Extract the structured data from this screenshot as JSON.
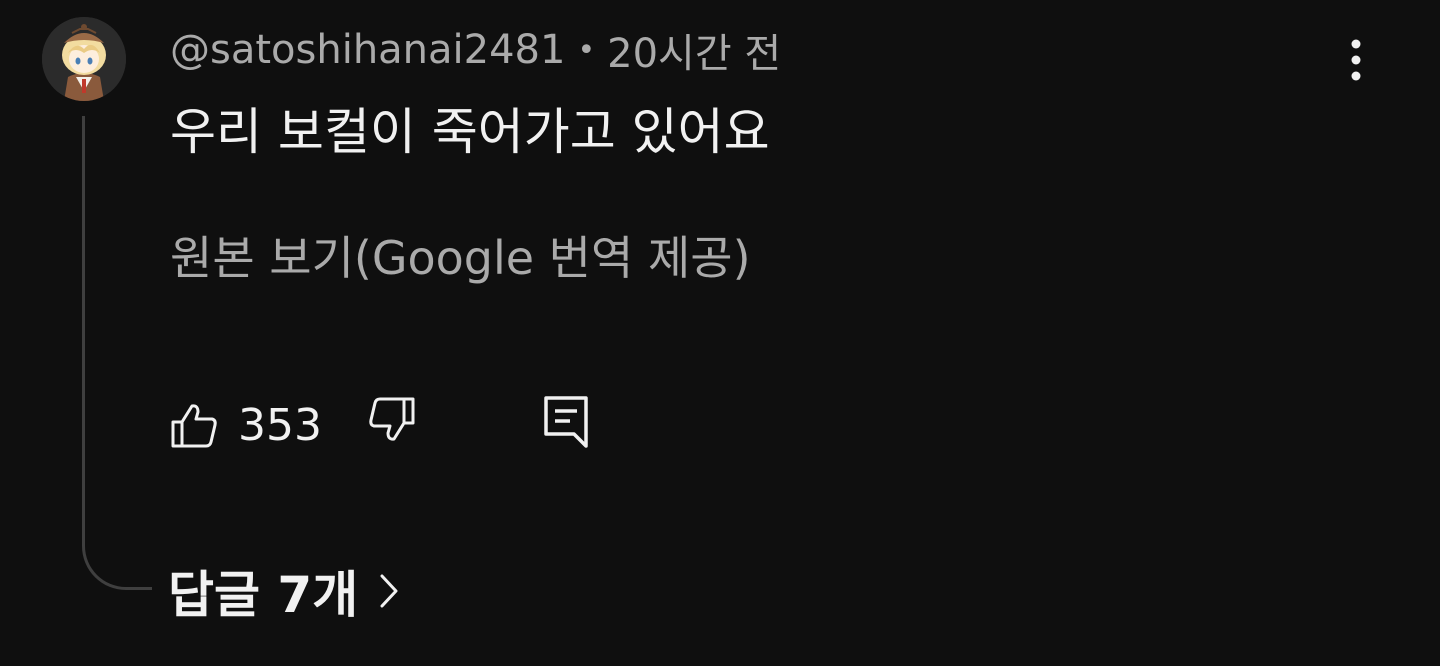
{
  "comment": {
    "author": "@satoshihanai2481",
    "separator": "•",
    "timestamp": "20시간 전",
    "text": "우리 보컬이 죽어가고 있어요",
    "translate_label": "원본 보기(Google 번역 제공)",
    "like_count": "353",
    "replies_label": "답글 7개"
  },
  "icons": {
    "avatar": "avatar-anime-character",
    "more": "more-vert-icon",
    "like": "thumb-up-icon",
    "dislike": "thumb-down-icon",
    "reply": "comment-reply-icon",
    "chevron": "chevron-right-icon"
  },
  "colors": {
    "background": "#0f0f0f",
    "primary_text": "#f1f1f1",
    "secondary_text": "#aaaaaa",
    "thread_line": "#3f3f3f"
  }
}
